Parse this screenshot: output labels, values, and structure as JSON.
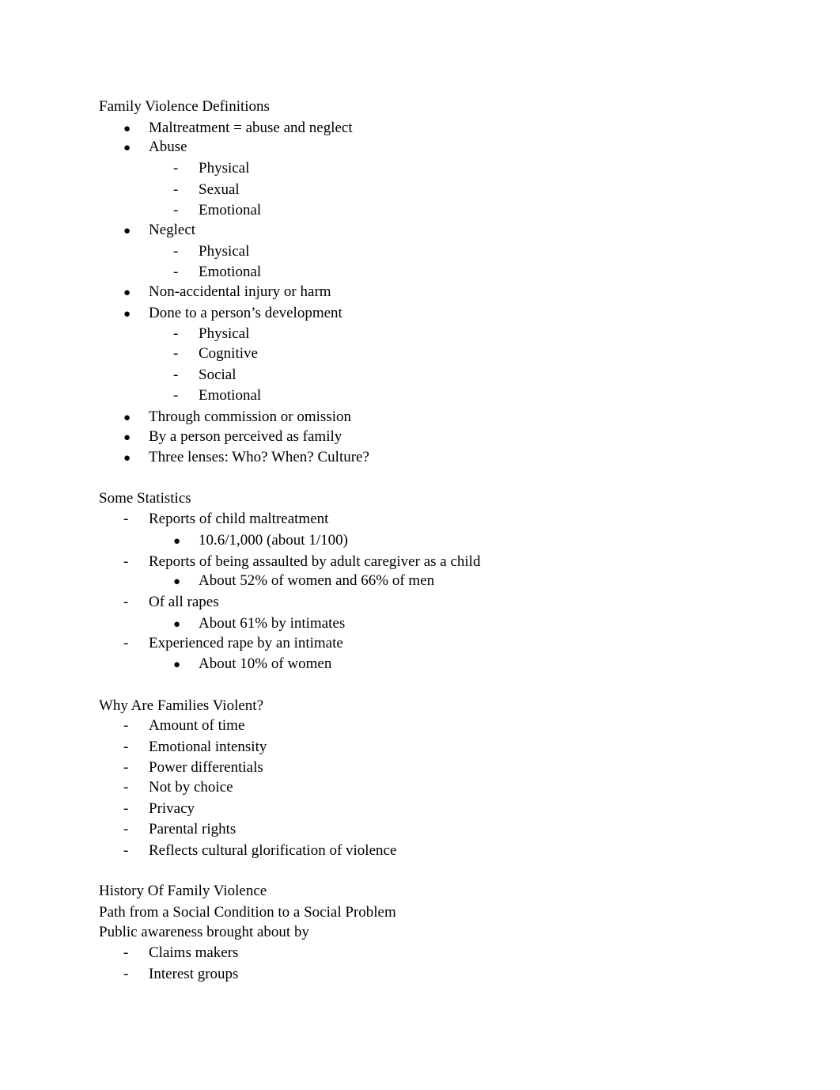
{
  "document": {
    "sections": [
      {
        "heading": "Family Violence Definitions",
        "items": [
          {
            "marker": "bullet",
            "level": 1,
            "text": "Maltreatment = abuse and neglect"
          },
          {
            "marker": "bullet",
            "level": 1,
            "text": "Abuse"
          },
          {
            "marker": "dash",
            "level": 2,
            "text": "Physical"
          },
          {
            "marker": "dash",
            "level": 2,
            "text": "Sexual"
          },
          {
            "marker": "dash",
            "level": 2,
            "text": "Emotional"
          },
          {
            "marker": "bullet",
            "level": 1,
            "text": "Neglect"
          },
          {
            "marker": "dash",
            "level": 2,
            "text": "Physical"
          },
          {
            "marker": "dash",
            "level": 2,
            "text": "Emotional"
          },
          {
            "marker": "bullet",
            "level": 1,
            "text": "Non-accidental injury or harm"
          },
          {
            "marker": "bullet",
            "level": 1,
            "text": "Done to a person’s development"
          },
          {
            "marker": "dash",
            "level": 2,
            "text": "Physical"
          },
          {
            "marker": "dash",
            "level": 2,
            "text": "Cognitive"
          },
          {
            "marker": "dash",
            "level": 2,
            "text": "Social"
          },
          {
            "marker": "dash",
            "level": 2,
            "text": "Emotional"
          },
          {
            "marker": "bullet",
            "level": 1,
            "text": "Through commission or omission"
          },
          {
            "marker": "bullet",
            "level": 1,
            "text": "By a person perceived as family"
          },
          {
            "marker": "bullet",
            "level": 1,
            "text": "Three lenses: Who? When? Culture?"
          }
        ]
      },
      {
        "heading": "Some Statistics",
        "items": [
          {
            "marker": "dash",
            "level": 1,
            "text": "Reports of child maltreatment"
          },
          {
            "marker": "bullet",
            "level": 2,
            "text": "10.6/1,000 (about 1/100)"
          },
          {
            "marker": "dash",
            "level": 1,
            "text": "Reports of being assaulted by adult caregiver as a child"
          },
          {
            "marker": "bullet",
            "level": 2,
            "text": "About 52% of women and 66% of men"
          },
          {
            "marker": "dash",
            "level": 1,
            "text": "Of all rapes"
          },
          {
            "marker": "bullet",
            "level": 2,
            "text": "About 61% by intimates"
          },
          {
            "marker": "dash",
            "level": 1,
            "text": "Experienced rape by an intimate"
          },
          {
            "marker": "bullet",
            "level": 2,
            "text": "About 10% of women"
          }
        ]
      },
      {
        "heading": "Why Are Families Violent?",
        "items": [
          {
            "marker": "dash",
            "level": 1,
            "text": "Amount of time"
          },
          {
            "marker": "dash",
            "level": 1,
            "text": "Emotional intensity"
          },
          {
            "marker": "dash",
            "level": 1,
            "text": "Power differentials"
          },
          {
            "marker": "dash",
            "level": 1,
            "text": "Not by choice"
          },
          {
            "marker": "dash",
            "level": 1,
            "text": "Privacy"
          },
          {
            "marker": "dash",
            "level": 1,
            "text": "Parental rights"
          },
          {
            "marker": "dash",
            "level": 1,
            "text": "Reflects cultural glorification of violence"
          }
        ]
      },
      {
        "heading": "History Of Family Violence",
        "paragraphs": [
          "Path from a Social Condition to a Social Problem",
          "Public awareness brought about by"
        ],
        "items": [
          {
            "marker": "dash",
            "level": 1,
            "text": "Claims makers"
          },
          {
            "marker": "dash",
            "level": 1,
            "text": "Interest groups"
          }
        ]
      }
    ]
  }
}
